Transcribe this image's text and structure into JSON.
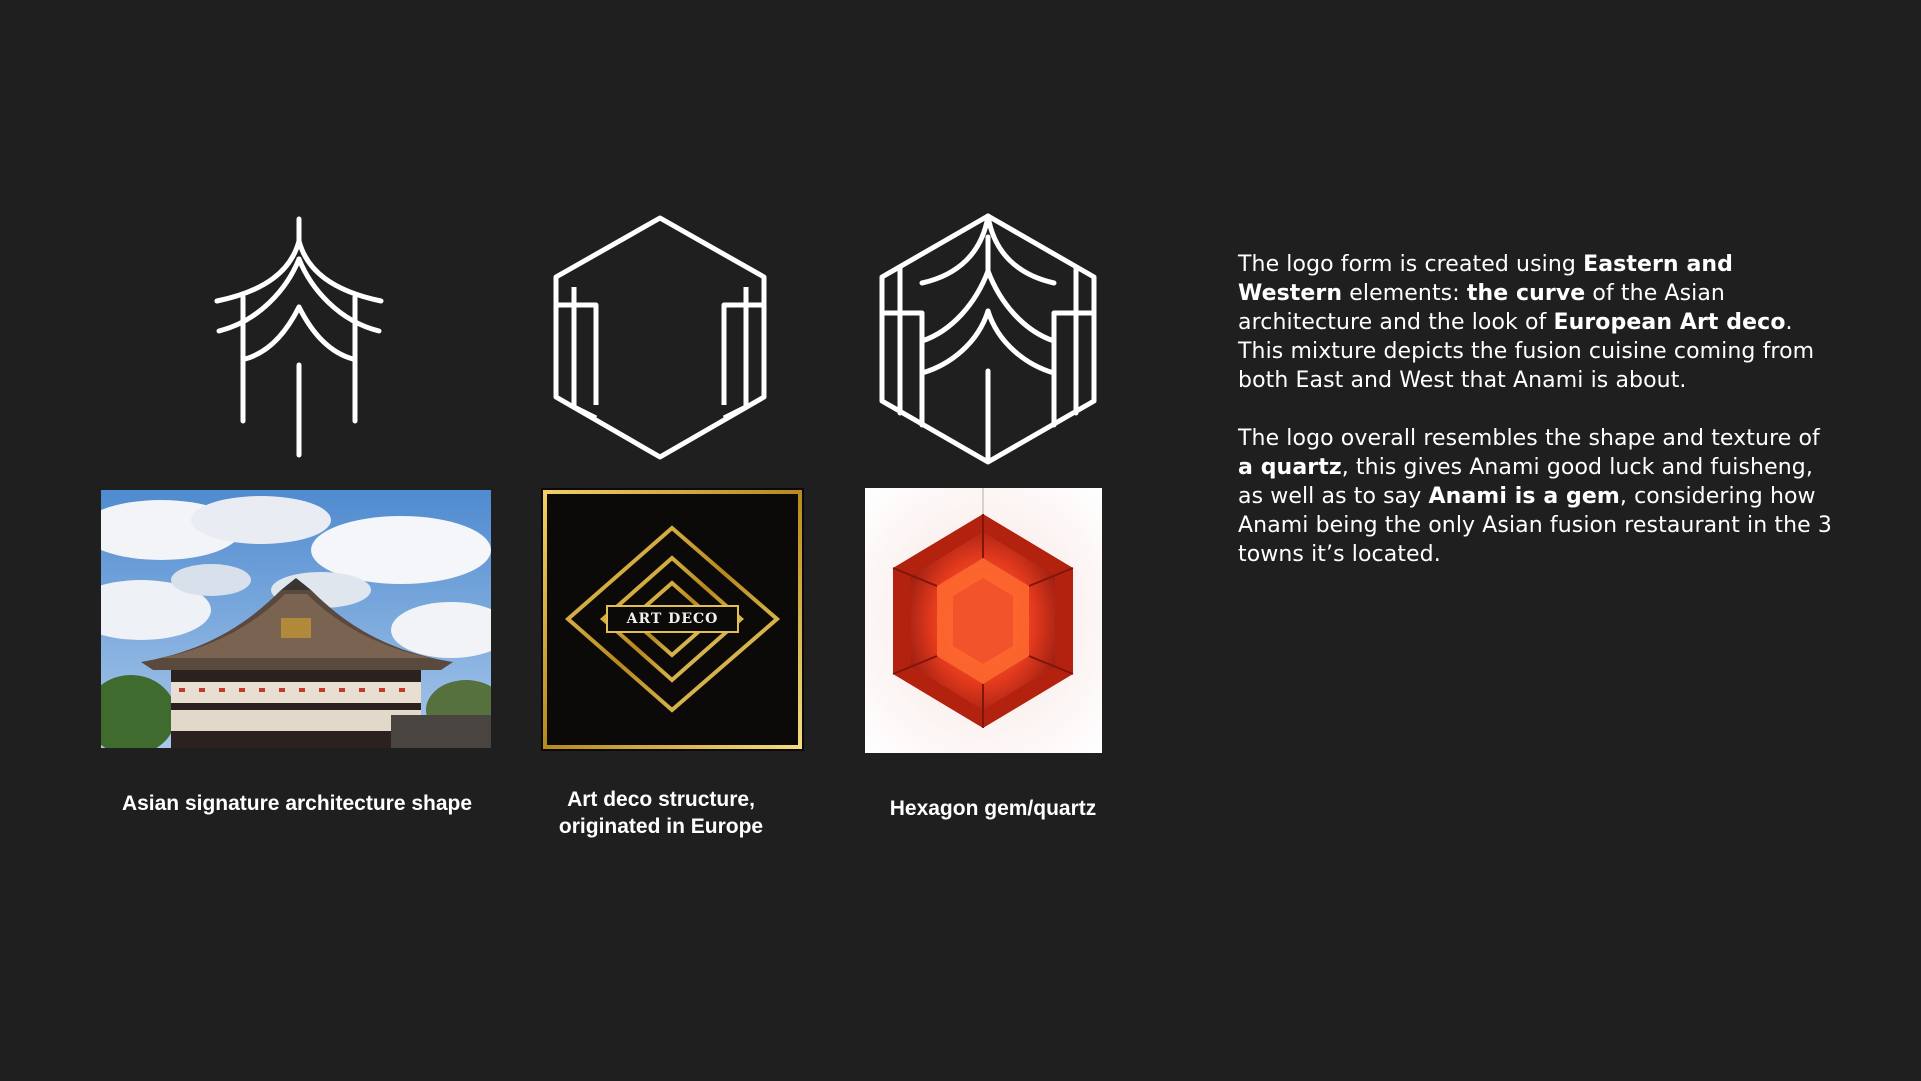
{
  "slide": {
    "background": "#1f1f1f",
    "logo_stroke": "#ffffff"
  },
  "items": [
    {
      "logo_icon": "pagoda-roof-icon",
      "image_description_icon": "asian-temple-photo",
      "caption": "Asian signature architecture shape"
    },
    {
      "logo_icon": "hexagon-art-deco-icon",
      "image_description_icon": "art-deco-gold-pattern",
      "image_text": "ART DECO",
      "caption_line1": "Art deco structure,",
      "caption_line2": "originated in Europe"
    },
    {
      "logo_icon": "hexagon-gem-logo-icon",
      "image_description_icon": "red-hexagon-quartz-photo",
      "caption": "Hexagon gem/quartz"
    }
  ],
  "description": {
    "p1": {
      "t1": "The logo form is created using ",
      "b1": "Eastern and Western",
      "t2": " elements: ",
      "b2": "the curve",
      "t3": " of the Asian architecture and the look of ",
      "b3": "European Art deco",
      "t4": ". This mixture depicts the fusion cuisine coming from both East and West that Anami is about."
    },
    "p2": {
      "t1": "The logo overall resembles the shape and texture of ",
      "b1": "a quartz",
      "t2": ", this gives Anami good luck and fuisheng, as well as to say ",
      "b2": "Anami is a gem",
      "t3": ", considering how Anami being the only Asian fusion restaurant in the 3 towns it’s located."
    }
  },
  "colors": {
    "gold": "#d4a72c",
    "gem_red": "#d8341c",
    "sky_blue": "#5f95d0"
  }
}
